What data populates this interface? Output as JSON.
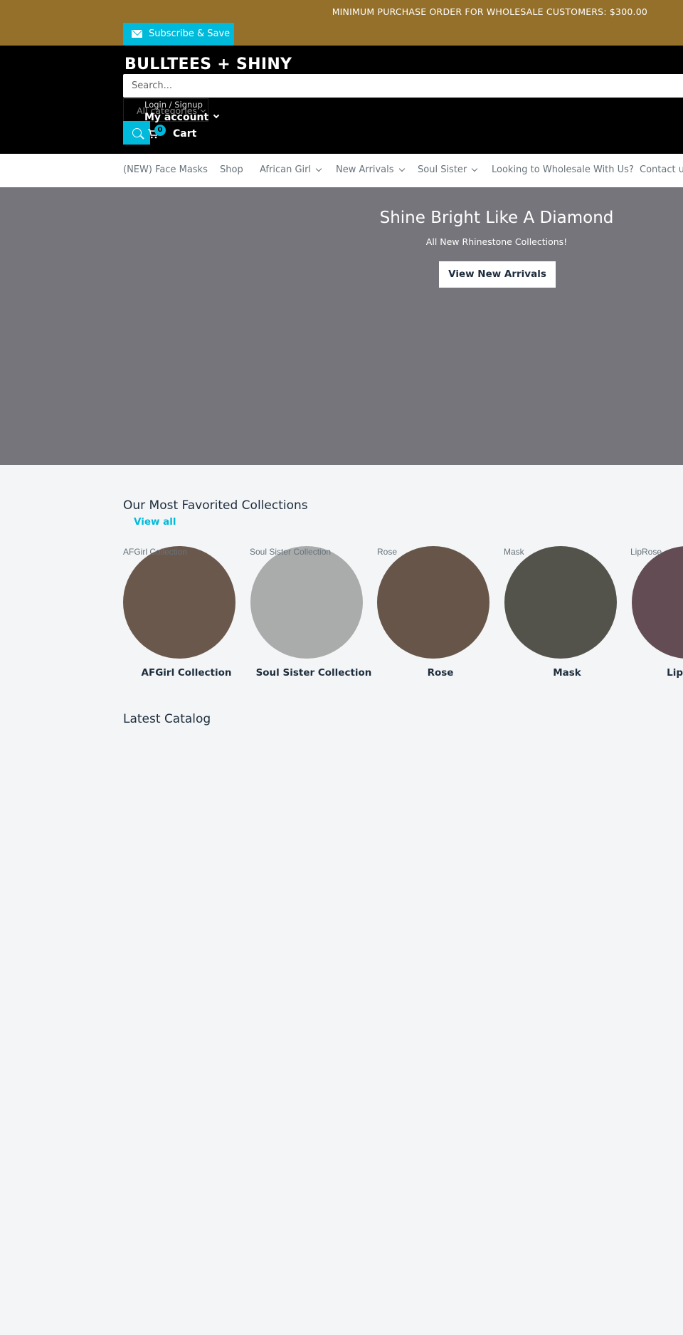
{
  "announcement": {
    "text": "MINIMUM PURCHASE ORDER FOR WHOLESALE CUSTOMERS: $300.00",
    "subscribe_label": "Subscribe & Save",
    "background": "#94702a"
  },
  "header": {
    "logo": "BULLTEES + SHINY",
    "search_placeholder": "Search...",
    "category_label": "All categories",
    "login_label": "Login / Signup",
    "account_label": "My account",
    "cart_count": "0",
    "cart_label": "Cart"
  },
  "nav": {
    "items": [
      {
        "label": "(NEW) Face Masks"
      },
      {
        "label": "Shop"
      },
      {
        "label": "African Girl"
      },
      {
        "label": "New Arrivals"
      },
      {
        "label": "Soul Sister"
      },
      {
        "label": "Looking to Wholesale With Us?"
      },
      {
        "label": "Contact us"
      }
    ]
  },
  "hero": {
    "title": "Shine Bright Like A Diamond",
    "subtitle": "All New Rhinestone Collections!",
    "button_label": "View New Arrivals"
  },
  "collections": {
    "title": "Our Most Favorited Collections",
    "view_all": "View all",
    "items": [
      {
        "image_alt": "AFGirl Collection",
        "name": "AFGirl Collection",
        "color": "#6b584d"
      },
      {
        "image_alt": "Soul Sister Collection",
        "name": "Soul Sister Collection",
        "color": "#aaacac"
      },
      {
        "image_alt": "Rose",
        "name": "Rose",
        "color": "#665548"
      },
      {
        "image_alt": "Mask",
        "name": "Mask",
        "color": "#53534b"
      },
      {
        "image_alt": "LipRose",
        "name": "LipRose",
        "color": "#634c54"
      }
    ]
  },
  "latest": {
    "title": "Latest Catalog"
  },
  "colors": {
    "accent": "#00badb",
    "heading": "#1e2d3d"
  }
}
